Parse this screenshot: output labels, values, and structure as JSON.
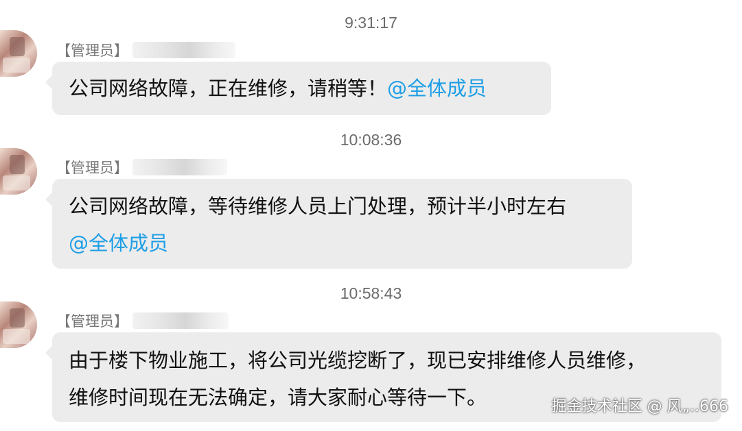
{
  "messages": [
    {
      "time": "9:31:17",
      "sender_tag": "【管理员】",
      "lines": [
        "公司网络故障，正在维修，请稍等！"
      ],
      "mention": "@全体成员"
    },
    {
      "time": "10:08:36",
      "sender_tag": "【管理员】",
      "lines": [
        "公司网络故障，等待维修人员上门处理，预计半小时左右"
      ],
      "mention": "@全体成员"
    },
    {
      "time": "10:58:43",
      "sender_tag": "【管理员】",
      "lines": [
        "由于楼下物业施工，将公司光缆挖断了，现已安排维修人员维修，",
        "维修时间现在无法确定，请大家耐心等待一下。"
      ],
      "mention": ""
    }
  ],
  "watermark": "掘金技术社区 @ 风„..666",
  "colors": {
    "bubble": "#ececec",
    "mention": "#1e9ee6",
    "timestamp": "#6b6b6b",
    "sender": "#777777"
  }
}
